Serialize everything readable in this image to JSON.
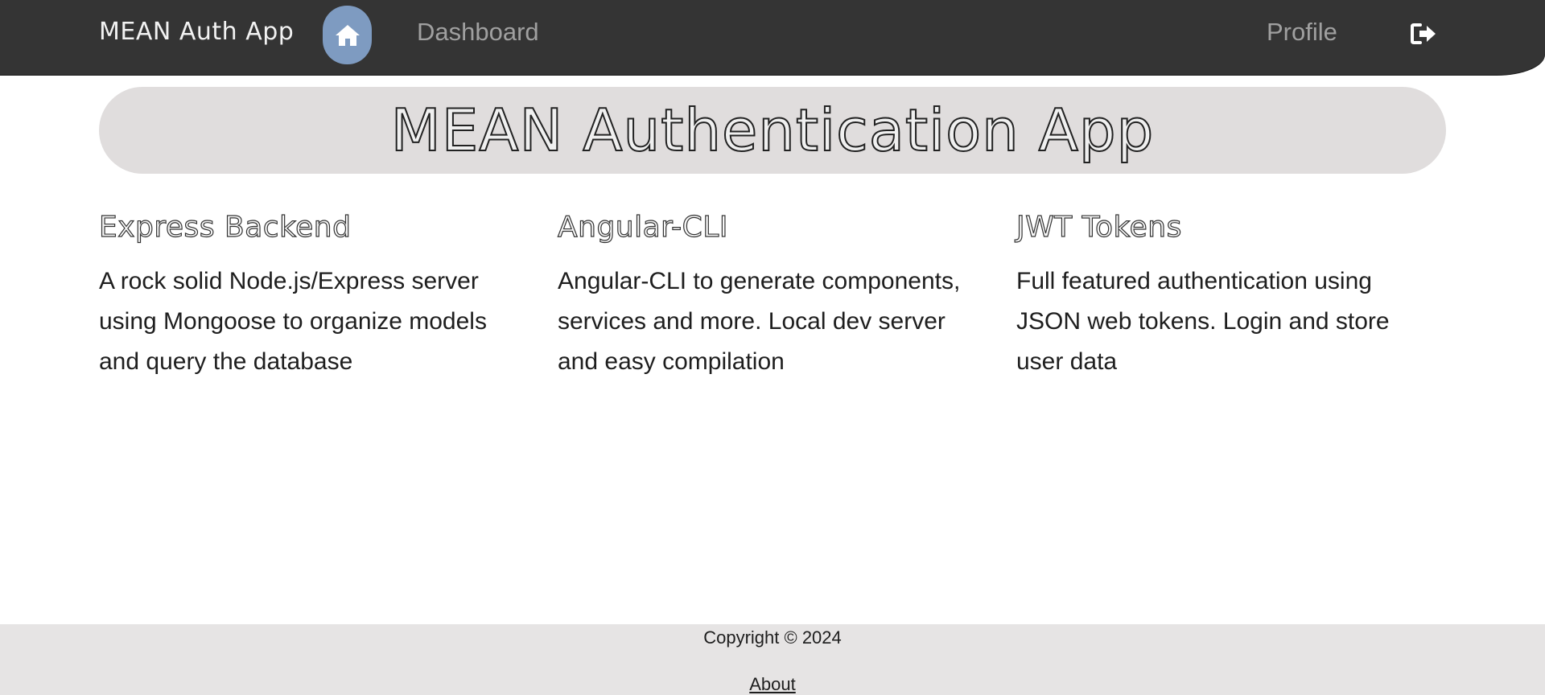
{
  "navbar": {
    "brand": "MEAN Auth App",
    "home_icon": "home-icon",
    "links": {
      "dashboard": "Dashboard",
      "profile": "Profile"
    },
    "logout_icon": "sign-out-icon",
    "colors": {
      "background": "#343434",
      "home_button": "#7e9bc1",
      "link": "#a0a0a0",
      "brand": "#f2f2f2"
    }
  },
  "hero": {
    "title": "MEAN Authentication App",
    "background": "#e0dddd"
  },
  "features": [
    {
      "title": "Express Backend",
      "description": "A rock solid Node.js/Express server using Mongoose to organize models and query the database"
    },
    {
      "title": "Angular-CLI",
      "description": "Angular-CLI to generate components, services and more. Local dev server and easy compilation"
    },
    {
      "title": "JWT Tokens",
      "description": "Full featured authentication using JSON web tokens. Login and store user data"
    }
  ],
  "footer": {
    "copyright": "Copyright © 2024",
    "about": "About",
    "background": "#e6e4e4"
  }
}
